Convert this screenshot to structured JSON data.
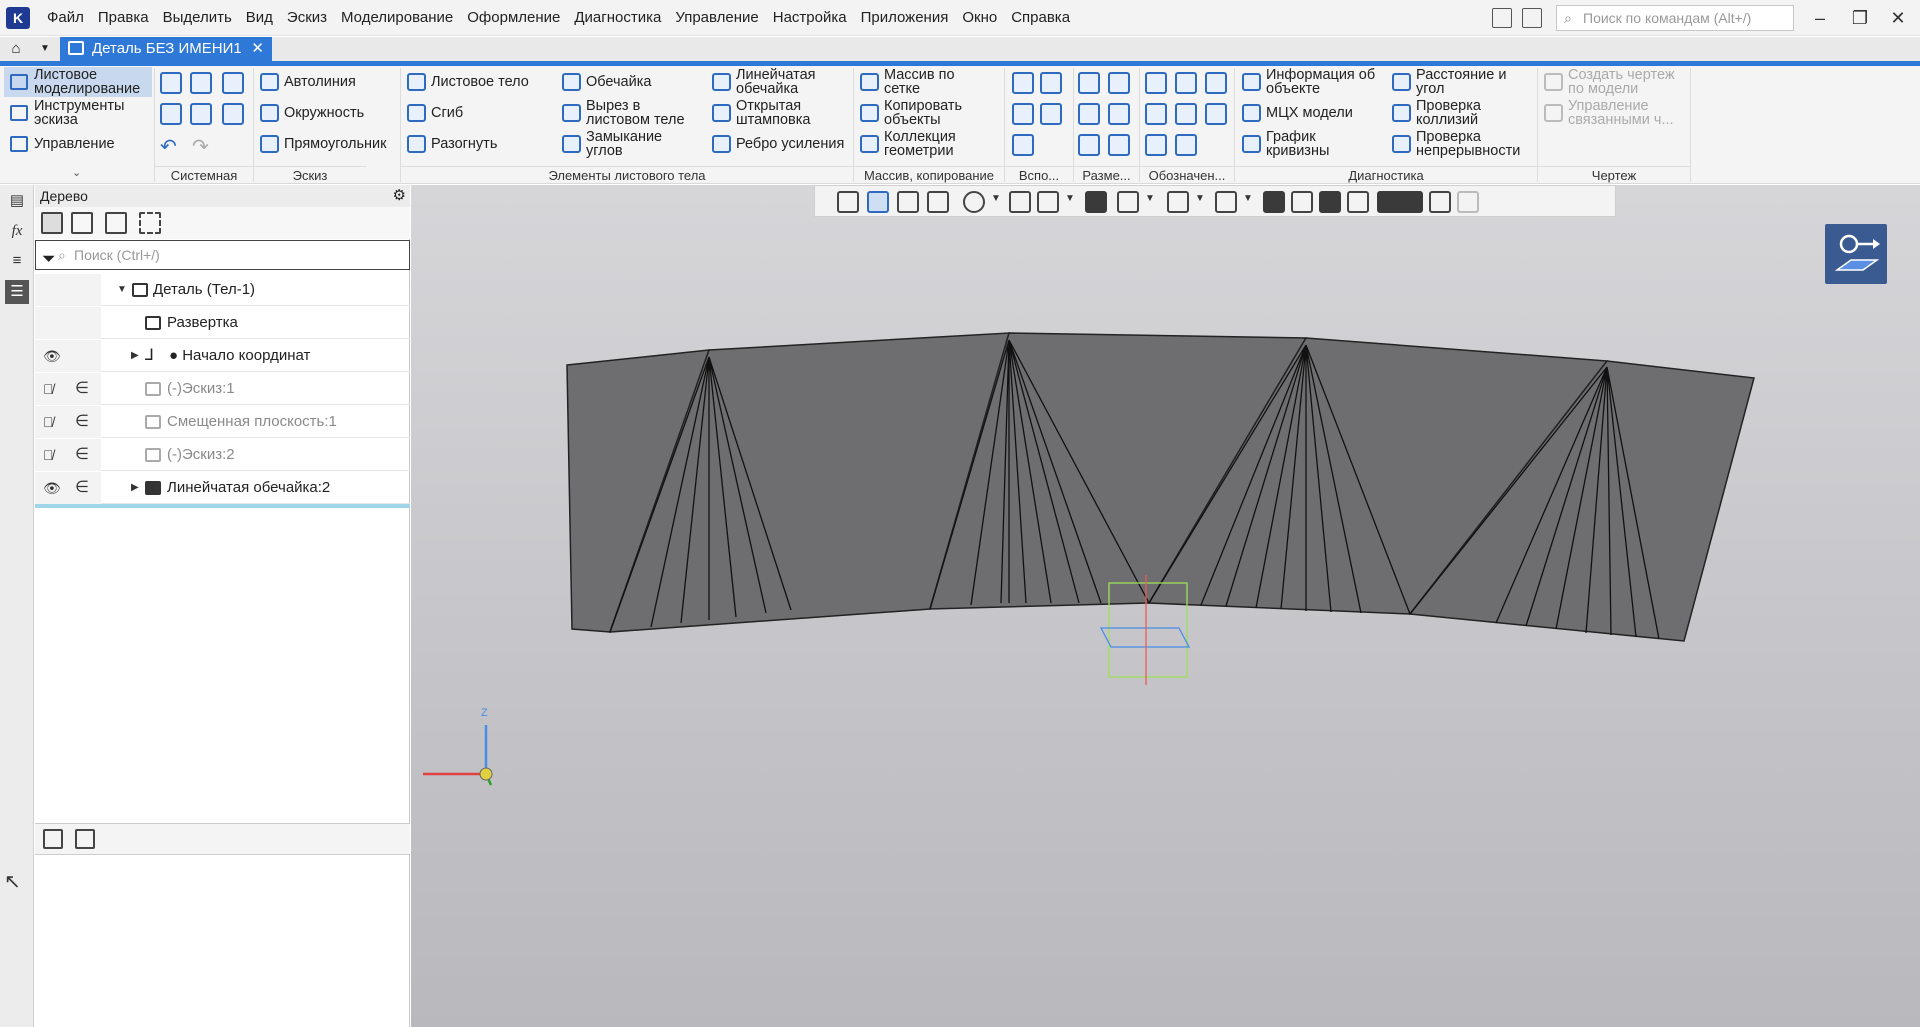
{
  "app": {
    "menu": [
      "Файл",
      "Правка",
      "Выделить",
      "Вид",
      "Эскиз",
      "Моделирование",
      "Оформление",
      "Диагностика",
      "Управление",
      "Настройка",
      "Приложения",
      "Окно",
      "Справка"
    ],
    "search_placeholder": "Поиск по командам (Alt+/)",
    "window_controls": {
      "minimize": "–",
      "maximize": "❐",
      "close": "✕"
    }
  },
  "tabs": {
    "active": "Деталь БЕЗ ИМЕНИ1",
    "close": "✕"
  },
  "ribbon": {
    "side": [
      "Листовое моделирование",
      "Инструменты эскиза",
      "Управление"
    ],
    "eskiz": [
      "Автолиния",
      "Окружность",
      "Прямоугольник"
    ],
    "sheet_col1": [
      "Листовое тело",
      "Сгиб",
      "Разогнуть"
    ],
    "sheet_col2": [
      "Обечайка",
      "Вырез в листовом теле",
      "Замыкание углов"
    ],
    "sheet_col3": [
      "Линейчатая обечайка",
      "Открытая штамповка",
      "Ребро усиления"
    ],
    "array": [
      "Массив по сетке",
      "Копировать объекты",
      "Коллекция геометрии"
    ],
    "diag_col1": [
      "Информация об объекте",
      "МЦХ модели",
      "График кривизны"
    ],
    "diag_col2": [
      "Расстояние и угол",
      "Проверка коллизий",
      "Проверка непрерывности"
    ],
    "drawing": [
      "Создать чертеж по модели",
      "Управление связанными ч..."
    ],
    "groups": {
      "system": "Системная",
      "sketch": "Эскиз",
      "sheet": "Элементы листового тела",
      "array": "Массив, копирование",
      "aux": "Вспо...",
      "dims": "Разме...",
      "notation": "Обозначен...",
      "diag": "Диагностика",
      "drawing": "Чертеж"
    }
  },
  "tree": {
    "title": "Дерево",
    "search_placeholder": "Поиск (Ctrl+/)",
    "root": "Деталь (Тел-1)",
    "items": [
      "Развертка",
      "● Начало координат",
      "(-)Эскиз:1",
      "Смещенная плоскость:1",
      "(-)Эскиз:2",
      "Линейчатая обечайка:2"
    ]
  },
  "axes": {
    "z": "Z"
  }
}
